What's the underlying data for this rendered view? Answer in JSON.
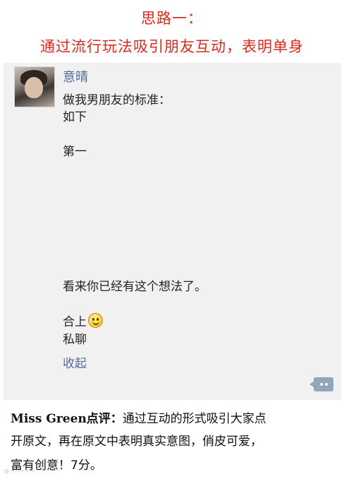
{
  "heading": {
    "line1": "思路一：",
    "line2": "通过流行玩法吸引朋友互动，表明单身"
  },
  "post": {
    "author": "意晴",
    "lines": [
      "做我男朋友的标准：",
      "如下",
      "第一",
      "看来你已经有这个想法了。",
      "合上",
      "私聊"
    ],
    "collapse_label": "收起",
    "emoji": "smiley-icon"
  },
  "review": {
    "prefix": "Miss Green点评：",
    "line1": "通过互动的形式吸引大家点",
    "line2": "开原文，再在原文中表明真实意图，俏皮可爱，",
    "line3": "富有创意！7分。"
  },
  "colors": {
    "heading": "#d92b1f",
    "link": "#556b98",
    "card_bg": "#f1f1f1",
    "comment_button": "#8fa6bd"
  }
}
